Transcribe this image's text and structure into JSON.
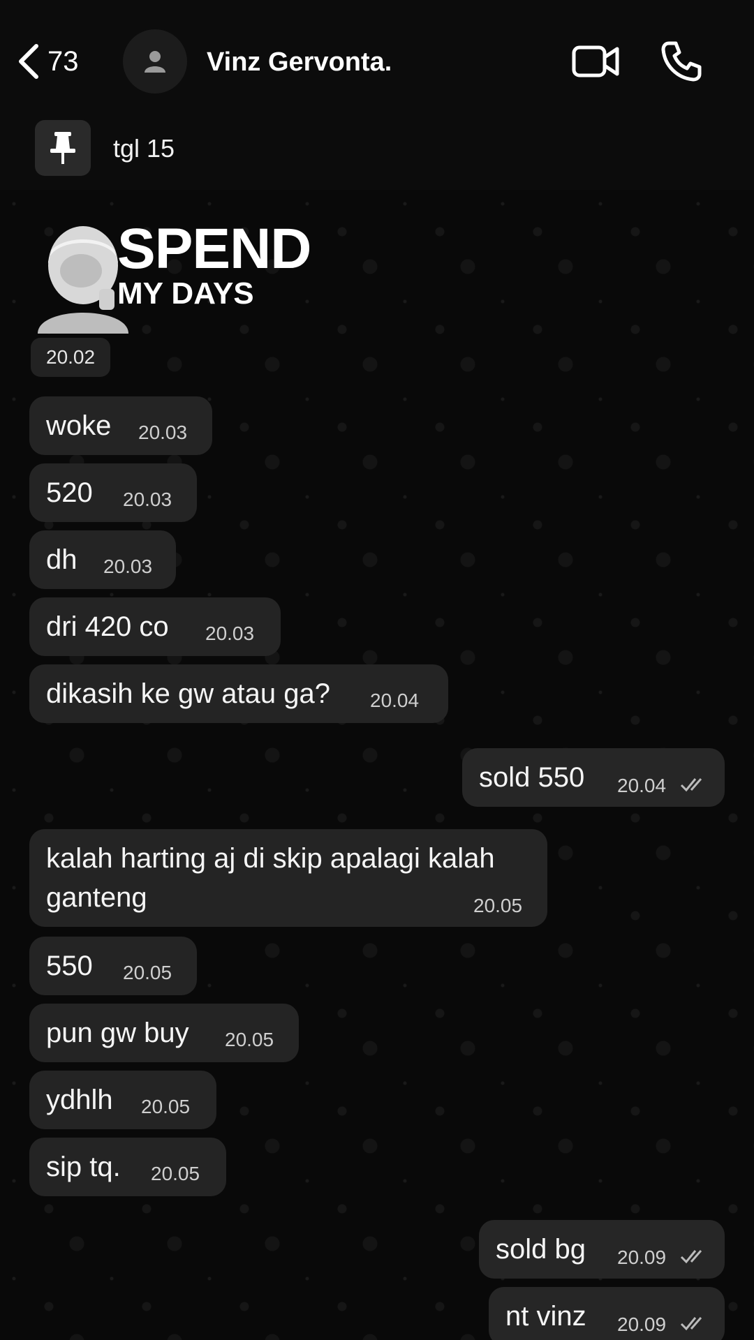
{
  "header": {
    "back_count": "73",
    "contact_name": "Vinz Gervonta."
  },
  "pinned": {
    "text": "tgl 15"
  },
  "sticker": {
    "line1": "SPEND",
    "line2": "MY DAYS",
    "time": "20.02"
  },
  "messages": [
    {
      "text": "woke",
      "time": "20.03",
      "direction": "in"
    },
    {
      "text": "520",
      "time": "20.03",
      "direction": "in"
    },
    {
      "text": "dh",
      "time": "20.03",
      "direction": "in"
    },
    {
      "text": "dri 420 co",
      "time": "20.03",
      "direction": "in"
    },
    {
      "text": "dikasih ke gw atau ga?",
      "time": "20.04",
      "direction": "in"
    },
    {
      "text": "sold 550",
      "time": "20.04",
      "direction": "out",
      "status": "read"
    },
    {
      "text_line1": "kalah harting aj di skip apalagi kalah",
      "text_line2": "ganteng",
      "time": "20.05",
      "direction": "in"
    },
    {
      "text": "550",
      "time": "20.05",
      "direction": "in"
    },
    {
      "text": "pun gw buy",
      "time": "20.05",
      "direction": "in"
    },
    {
      "text": "ydhlh",
      "time": "20.05",
      "direction": "in"
    },
    {
      "text": "sip tq.",
      "time": "20.05",
      "direction": "in"
    },
    {
      "text": "sold bg",
      "time": "20.09",
      "direction": "out",
      "status": "read"
    },
    {
      "text": "nt vinz",
      "time": "20.09",
      "direction": "out",
      "status": "read"
    }
  ],
  "icons": {
    "back": "chevron-left-icon",
    "avatar": "person-icon",
    "video": "video-camera-icon",
    "call": "phone-icon",
    "pin": "pin-icon",
    "read": "double-check-icon"
  },
  "colors": {
    "background": "#0b0b0b",
    "bubble": "#242424",
    "text": "#f5f5f5"
  }
}
